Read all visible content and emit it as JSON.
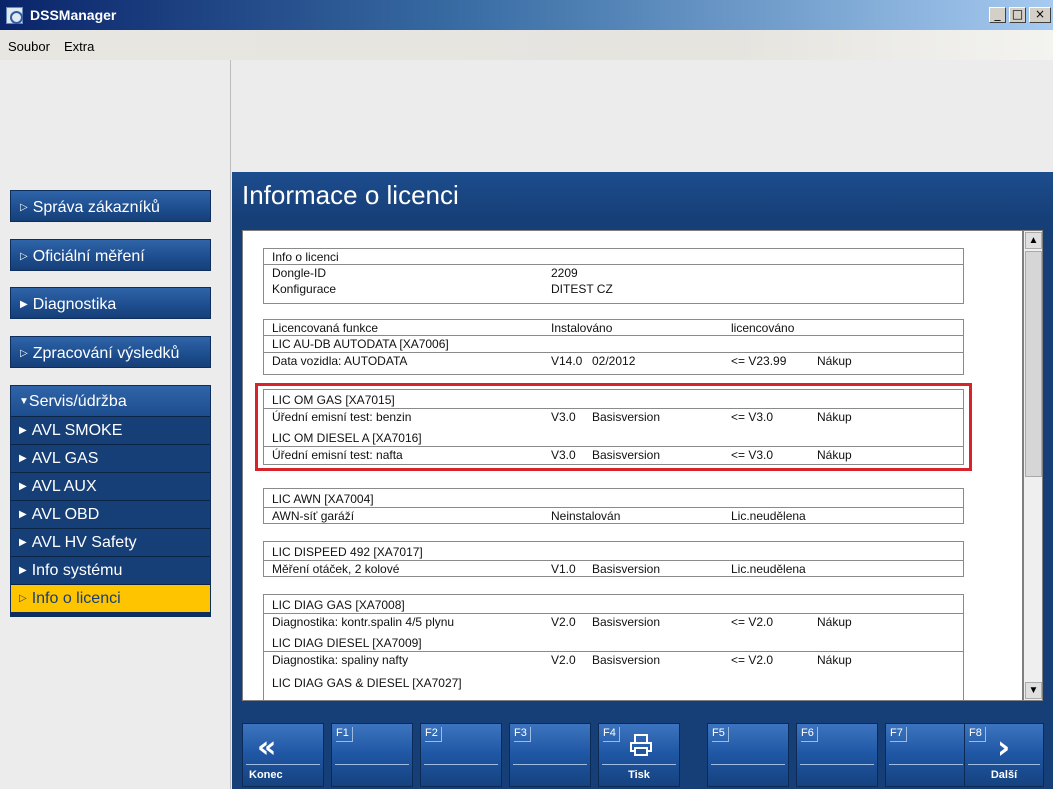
{
  "window": {
    "title": "DSSManager",
    "controls": [
      "_",
      "□",
      "×"
    ]
  },
  "menu": [
    "Soubor",
    "Extra"
  ],
  "sidebar": {
    "items": [
      {
        "label": "Správa zákazníků"
      },
      {
        "label": "Oficiální měření"
      },
      {
        "label": "Diagnostika"
      },
      {
        "label": "Zpracování výsledků"
      }
    ],
    "group": {
      "label": "Servis/údržba",
      "children": [
        "AVL SMOKE",
        "AVL GAS",
        "AVL AUX",
        "AVL OBD",
        "AVL HV Safety",
        "Info systému",
        "Info o licenci"
      ],
      "active": "Info o licenci"
    }
  },
  "page": {
    "title": "Informace o licenci"
  },
  "license": {
    "info": {
      "heading": "Info o licenci",
      "rows": [
        {
          "label": "Dongle-ID",
          "value": "2209"
        },
        {
          "label": "Konfigurace",
          "value": "DITEST CZ"
        }
      ]
    },
    "columns": {
      "function": "Licencovaná funkce",
      "installed": "Instalováno",
      "licensed": "licencováno"
    },
    "blocks": [
      {
        "entries": [
          {
            "name": "LIC AU-DB AUTODATA [XA7006]",
            "desc": "Data vozidla: AUTODATA",
            "ver": "V14.0",
            "build": "02/2012",
            "limit": "<= V23.99",
            "status": "Nákup"
          }
        ]
      },
      {
        "highlighted": true,
        "entries": [
          {
            "name": "LIC OM GAS [XA7015]",
            "desc": "Úřední emisní test: benzin",
            "ver": "V3.0",
            "build": "Basisversion",
            "limit": "<= V3.0",
            "status": "Nákup"
          },
          {
            "name": "LIC OM DIESEL A [XA7016]",
            "desc": "Úřední emisní test: nafta",
            "ver": "V3.0",
            "build": "Basisversion",
            "limit": "<= V3.0",
            "status": "Nákup"
          }
        ]
      },
      {
        "entries": [
          {
            "name": "LIC AWN [XA7004]",
            "desc": "AWN-síť garáží",
            "ver": "Neinstalován",
            "build": "",
            "limit": "Lic.neudělena",
            "status": ""
          }
        ]
      },
      {
        "entries": [
          {
            "name": "LIC DISPEED 492 [XA7017]",
            "desc": "Měření otáček, 2 kolové",
            "ver": "V1.0",
            "build": "Basisversion",
            "limit": "Lic.neudělena",
            "status": ""
          }
        ]
      },
      {
        "entries": [
          {
            "name": "LIC DIAG GAS [XA7008]",
            "desc": "Diagnostika: kontr.spalin 4/5 plynu",
            "ver": "V2.0",
            "build": "Basisversion",
            "limit": "<= V2.0",
            "status": "Nákup"
          },
          {
            "name": "LIC DIAG DIESEL [XA7009]",
            "desc": "Diagnostika: spaliny nafty",
            "ver": "V2.0",
            "build": "Basisversion",
            "limit": "<= V2.0",
            "status": "Nákup"
          },
          {
            "name": "LIC DIAG GAS & DIESEL [XA7027]",
            "desc": "",
            "ver": "",
            "build": "",
            "limit": "",
            "status": ""
          }
        ]
      }
    ]
  },
  "fkeys": [
    {
      "key": "",
      "label": "Konec",
      "icon": "double-chevron-left-icon"
    },
    {
      "key": "F1",
      "label": "",
      "icon": ""
    },
    {
      "key": "F2",
      "label": "",
      "icon": ""
    },
    {
      "key": "F3",
      "label": "",
      "icon": ""
    },
    {
      "key": "F4",
      "label": "Tisk",
      "icon": "printer-icon"
    },
    {
      "key": "F5",
      "label": "",
      "icon": ""
    },
    {
      "key": "F6",
      "label": "",
      "icon": ""
    },
    {
      "key": "F7",
      "label": "",
      "icon": ""
    },
    {
      "key": "F8",
      "label": "Další",
      "icon": "chevron-right-icon"
    }
  ],
  "colors": {
    "navy": "#163f77",
    "active": "#ffc400",
    "highlight": "#d6242a"
  }
}
